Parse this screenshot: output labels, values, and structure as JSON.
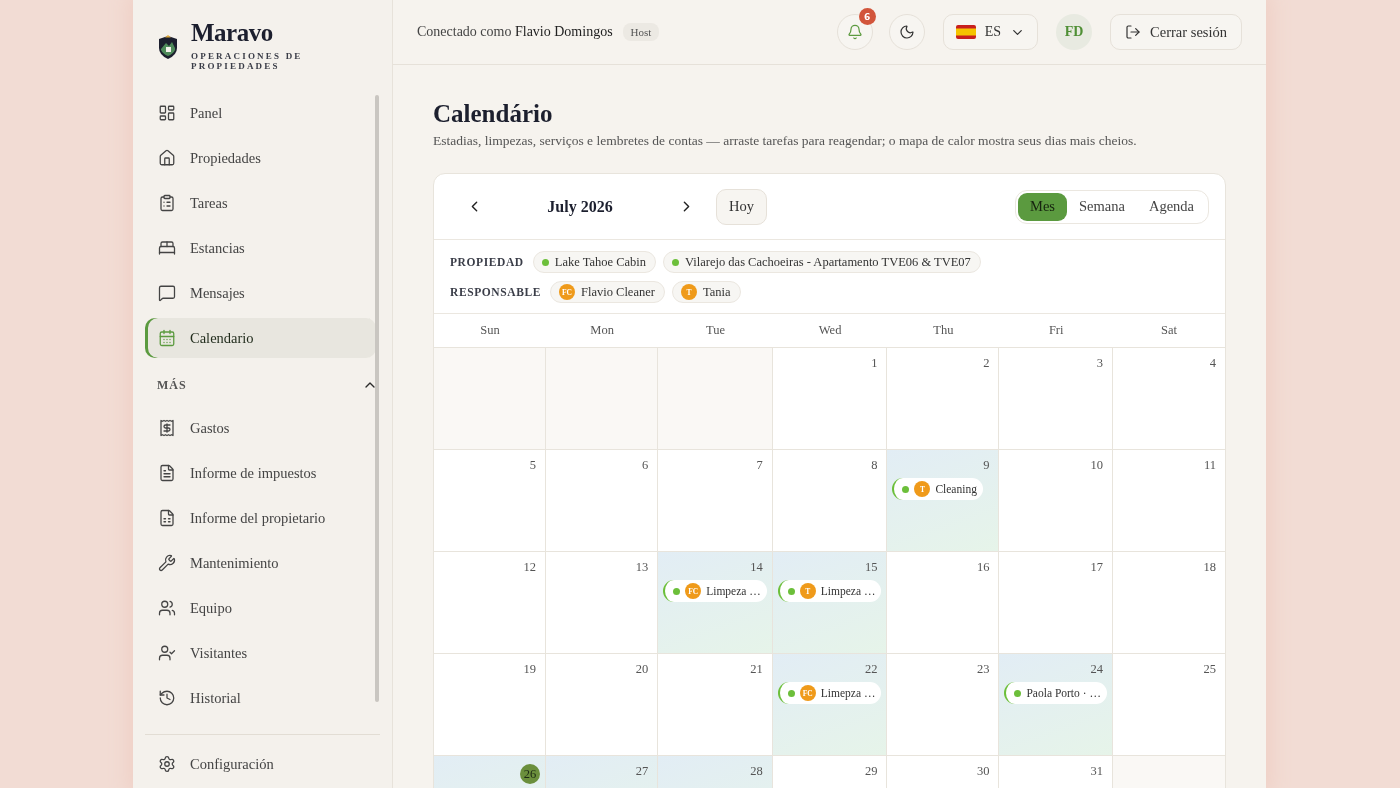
{
  "brand": {
    "name": "Maravo",
    "tagline": "OPERACIONES DE PROPIEDADES"
  },
  "sidebar": {
    "items": [
      {
        "label": "Panel",
        "selected": false
      },
      {
        "label": "Propiedades",
        "selected": false
      },
      {
        "label": "Tareas",
        "selected": false
      },
      {
        "label": "Estancias",
        "selected": false
      },
      {
        "label": "Mensajes",
        "selected": false
      },
      {
        "label": "Calendario",
        "selected": true
      }
    ],
    "more": {
      "label": "MÁS",
      "expanded": true,
      "items": [
        {
          "label": "Gastos",
          "selected": false
        },
        {
          "label": "Informe de impuestos",
          "selected": false
        },
        {
          "label": "Informe del propietario",
          "selected": false
        },
        {
          "label": "Mantenimiento",
          "selected": false
        },
        {
          "label": "Equipo",
          "selected": false
        },
        {
          "label": "Visitantes",
          "selected": false
        },
        {
          "label": "Historial",
          "selected": false
        }
      ]
    },
    "footer_items": [
      {
        "label": "Configuración",
        "selected": false
      }
    ]
  },
  "topbar": {
    "connected_prefix": "Conectado como",
    "user": "Flavio Domingos",
    "role": "Host",
    "notifications": "6",
    "language": "ES",
    "avatar": "FD",
    "logout": "Cerrar sesión"
  },
  "page": {
    "title": "Calendário",
    "subtitle": "Estadias, limpezas, serviços e lembretes de contas — arraste tarefas para reagendar; o mapa de calor mostra seus dias mais cheios."
  },
  "calendar": {
    "month": "July 2026",
    "today_button": "Hoy",
    "views": [
      {
        "label": "Mes",
        "selected": true
      },
      {
        "label": "Semana",
        "selected": false
      },
      {
        "label": "Agenda",
        "selected": false
      }
    ],
    "filters": [
      {
        "label": "PROPIEDAD",
        "chips": [
          {
            "kind": "dot",
            "label": "Lake Tahoe Cabin",
            "color": "#6cbf3a"
          },
          {
            "kind": "dot",
            "label": "Vilarejo das Cachoeiras - Apartamento TVE06 & TVE07",
            "color": "#6cbf3a"
          }
        ]
      },
      {
        "label": "RESPONSABLE",
        "chips": [
          {
            "kind": "avatar",
            "label": "Flavio Cleaner",
            "initials": "FC"
          },
          {
            "kind": "avatar",
            "label": "Tania",
            "initials": "T"
          }
        ]
      }
    ],
    "weekdays": [
      "Sun",
      "Mon",
      "Tue",
      "Wed",
      "Thu",
      "Fri",
      "Sat"
    ],
    "weeks": [
      [
        {
          "kind": "blank"
        },
        {
          "kind": "blank"
        },
        {
          "kind": "blank"
        },
        {
          "kind": "day",
          "day": "1",
          "heat": false
        },
        {
          "kind": "day",
          "day": "2",
          "heat": false
        },
        {
          "kind": "day",
          "day": "3",
          "heat": false
        },
        {
          "kind": "day",
          "day": "4",
          "heat": false
        }
      ],
      [
        {
          "kind": "day",
          "day": "5",
          "heat": false
        },
        {
          "kind": "day",
          "day": "6",
          "heat": false
        },
        {
          "kind": "day",
          "day": "7",
          "heat": false
        },
        {
          "kind": "day",
          "day": "8",
          "heat": false
        },
        {
          "kind": "day",
          "day": "9",
          "heat": true,
          "events": [
            {
              "title": "Cleaning",
              "initials": "T",
              "color": "#6cbf3a"
            }
          ]
        },
        {
          "kind": "day",
          "day": "10",
          "heat": false
        },
        {
          "kind": "day",
          "day": "11",
          "heat": false
        }
      ],
      [
        {
          "kind": "day",
          "day": "12",
          "heat": false
        },
        {
          "kind": "day",
          "day": "13",
          "heat": false
        },
        {
          "kind": "day",
          "day": "14",
          "heat": true,
          "events": [
            {
              "title": "Limpeza …",
              "initials": "FC",
              "color": "#6cbf3a"
            }
          ]
        },
        {
          "kind": "day",
          "day": "15",
          "heat": true,
          "events": [
            {
              "title": "Limpeza …",
              "initials": "T",
              "color": "#6cbf3a"
            }
          ]
        },
        {
          "kind": "day",
          "day": "16",
          "heat": false
        },
        {
          "kind": "day",
          "day": "17",
          "heat": false
        },
        {
          "kind": "day",
          "day": "18",
          "heat": false
        }
      ],
      [
        {
          "kind": "day",
          "day": "19",
          "heat": false
        },
        {
          "kind": "day",
          "day": "20",
          "heat": false
        },
        {
          "kind": "day",
          "day": "21",
          "heat": false
        },
        {
          "kind": "day",
          "day": "22",
          "heat": true,
          "events": [
            {
              "title": "Limepza …",
              "initials": "FC",
              "color": "#6cbf3a"
            }
          ]
        },
        {
          "kind": "day",
          "day": "23",
          "heat": false
        },
        {
          "kind": "day",
          "day": "24",
          "heat": true,
          "events": [
            {
              "title": "Paola Porto · …",
              "color": "#6cbf3a"
            }
          ]
        },
        {
          "kind": "day",
          "day": "25",
          "heat": false
        }
      ],
      [
        {
          "kind": "day",
          "day": "26",
          "heat": true,
          "today": true
        },
        {
          "kind": "day",
          "day": "27",
          "heat": true
        },
        {
          "kind": "day",
          "day": "28",
          "heat": true
        },
        {
          "kind": "day",
          "day": "29",
          "heat": false
        },
        {
          "kind": "day",
          "day": "30",
          "heat": false
        },
        {
          "kind": "day",
          "day": "31",
          "heat": false
        },
        {
          "kind": "blank"
        }
      ]
    ]
  }
}
